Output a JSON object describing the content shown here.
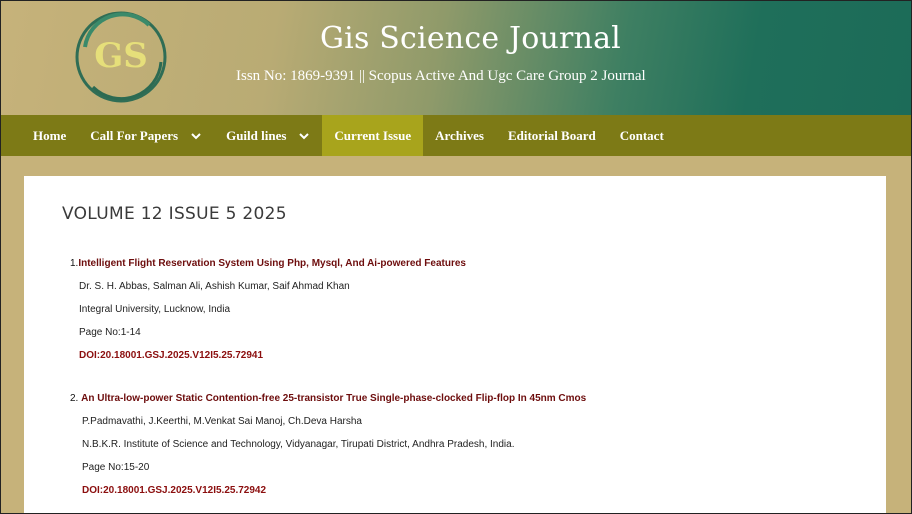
{
  "header": {
    "logo_text": "GS",
    "title": "Gis Science Journal",
    "subtitle": "Issn No: 1869-9391 || Scopus Active And Ugc Care Group 2 Journal"
  },
  "nav": {
    "items": [
      {
        "label": "Home",
        "dropdown": false,
        "active": false
      },
      {
        "label": "Call For Papers",
        "dropdown": true,
        "active": false
      },
      {
        "label": "Guild lines",
        "dropdown": true,
        "active": false
      },
      {
        "label": "Current Issue",
        "dropdown": false,
        "active": true
      },
      {
        "label": "Archives",
        "dropdown": false,
        "active": false
      },
      {
        "label": "Editorial Board",
        "dropdown": false,
        "active": false
      },
      {
        "label": "Contact",
        "dropdown": false,
        "active": false
      }
    ]
  },
  "main": {
    "volume_title": "VOLUME 12 ISSUE 5 2025",
    "articles": [
      {
        "number": "1.",
        "title": "Intelligent Flight Reservation System Using Php, Mysql, And Ai-powered Features",
        "authors": "Dr. S. H. Abbas, Salman Ali, Ashish Kumar, Saif Ahmad Khan",
        "affiliation": "Integral University, Lucknow, India",
        "pages": "Page No:1-14",
        "doi": "DOI:20.18001.GSJ.2025.V12I5.25.72941"
      },
      {
        "number": "2.",
        "title": "An Ultra-low-power Static Contention-free 25-transistor True Single-phase-clocked Flip-flop In 45nm Cmos",
        "authors": "P.Padmavathi, J.Keerthi, M.Venkat Sai Manoj, Ch.Deva Harsha",
        "affiliation": "N.B.K.R. Institute of Science and Technology, Vidyanagar, Tirupati District, Andhra Pradesh, India.",
        "pages": "Page No:15-20",
        "doi": "DOI:20.18001.GSJ.2025.V12I5.25.72942"
      }
    ]
  },
  "colors": {
    "nav_bg": "#7d7a16",
    "nav_active": "#a8a41c",
    "page_bg": "#c6b27a",
    "banner_green": "#1c6b58",
    "article_title": "#6d0d0d"
  }
}
